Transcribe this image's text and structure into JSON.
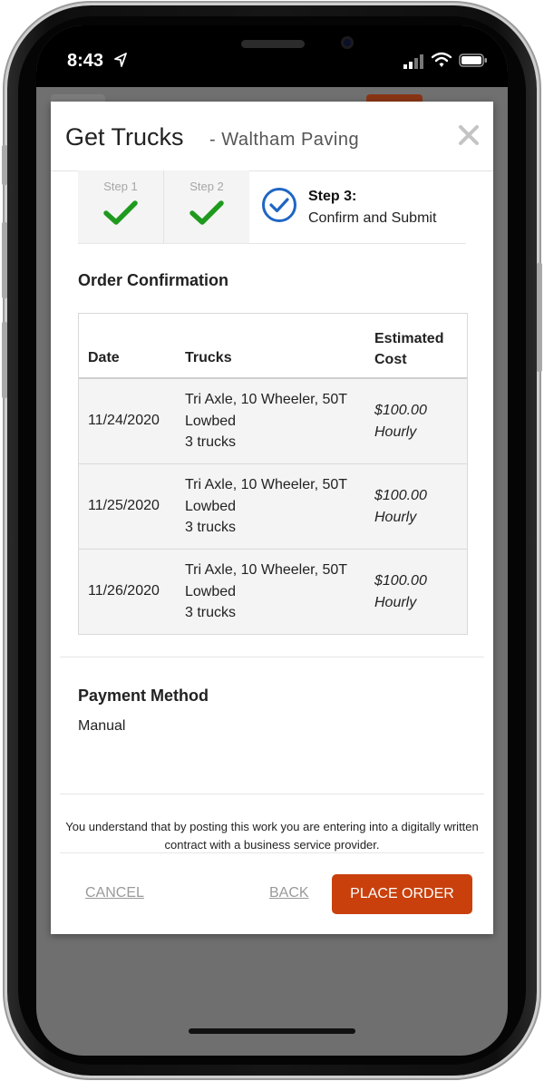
{
  "status_bar": {
    "time": "8:43"
  },
  "modal": {
    "title": "Get Trucks",
    "subtitle": "Waltham Paving",
    "close_icon": "close-icon"
  },
  "steps": [
    {
      "label": "Step 1",
      "state": "complete"
    },
    {
      "label": "Step 2",
      "state": "complete"
    },
    {
      "label": "Step 3:",
      "description": "Confirm and Submit",
      "state": "current"
    }
  ],
  "order": {
    "heading": "Order Confirmation",
    "columns": {
      "date": "Date",
      "trucks": "Trucks",
      "cost_line1": "Estimated",
      "cost_line2": "Cost"
    },
    "rows": [
      {
        "date": "11/24/2020",
        "trucks": [
          "Tri Axle, 10 Wheeler, 50T",
          "Lowbed",
          "3 trucks"
        ],
        "cost": "$100.00",
        "rate": "Hourly"
      },
      {
        "date": "11/25/2020",
        "trucks": [
          "Tri Axle, 10 Wheeler, 50T",
          "Lowbed",
          "3 trucks"
        ],
        "cost": "$100.00",
        "rate": "Hourly"
      },
      {
        "date": "11/26/2020",
        "trucks": [
          "Tri Axle, 10 Wheeler, 50T",
          "Lowbed",
          "3 trucks"
        ],
        "cost": "$100.00",
        "rate": "Hourly"
      }
    ]
  },
  "payment": {
    "heading": "Payment Method",
    "value": "Manual"
  },
  "disclaimer": "You understand that by posting this work you are entering into a digitally written contract with a business service provider.",
  "actions": {
    "cancel": "CANCEL",
    "back": "BACK",
    "place_order": "PLACE ORDER"
  },
  "colors": {
    "accent": "#c9400d",
    "check": "#1e9a1e",
    "step_circle": "#1f66c4"
  }
}
